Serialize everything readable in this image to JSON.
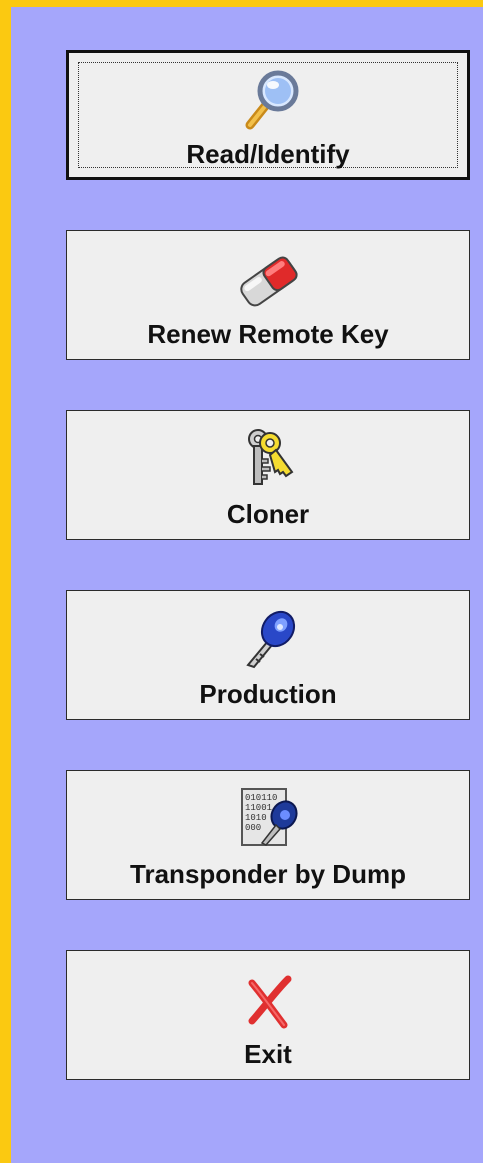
{
  "menu": {
    "buttons": [
      {
        "label": "Read/Identify",
        "icon": "magnifier-icon"
      },
      {
        "label": "Renew Remote Key",
        "icon": "eraser-icon"
      },
      {
        "label": "Cloner",
        "icon": "keys-icon"
      },
      {
        "label": "Production",
        "icon": "blue-key-icon"
      },
      {
        "label": "Transponder by Dump",
        "icon": "binary-dump-icon"
      },
      {
        "label": "Exit",
        "icon": "exit-x-icon"
      }
    ]
  },
  "colors": {
    "panel": "#a5a6fb",
    "frame": "#fbc911",
    "button_face": "#efefef"
  }
}
